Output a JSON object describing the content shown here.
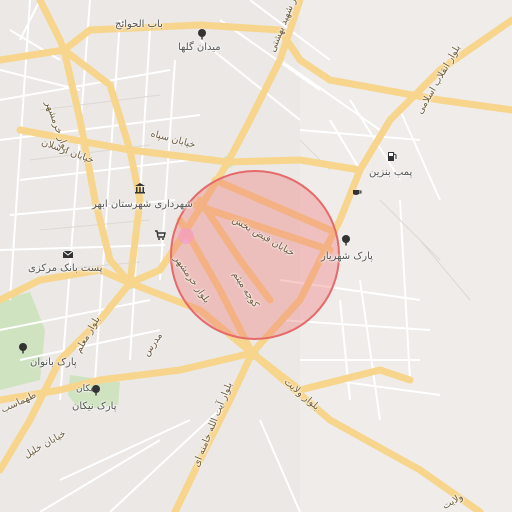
{
  "map": {
    "labels": {
      "bab_alhavaej": "باب الحوائج",
      "meydan_golha": "میدان گلها",
      "bolvar_sh_beheshti": "بلوار شهید بهشتی",
      "bolvar_enghelab": "بلوار انقلاب اسلامی",
      "bolvar_khorramshahr_n": "بلوار خرمشهر",
      "khiaban_sepah": "خیابان سپاه",
      "khiaban_arsalan": "خیابان ارسلان",
      "pomp_benzin": "پمپ بنزین",
      "shahrdari": "شهرداری شهرستان ابهر",
      "khiaban_feyz": "خیابان فیض بخش",
      "park_shahriar": "پارک شهریار",
      "post_bank": "پست بانک مرکزی",
      "bolvar_khorramshahr_s": "بلوار خرمشهر",
      "kooche_meysam": "کوچه میثم",
      "modarres": "مدرس",
      "bolvar_moallem": "بلوار معلم",
      "park_banovan": "پارک بانوان",
      "park_nikan": "پارک نیکان",
      "tahmasb": "طهماسب",
      "bolvar_velayat": "بلوار ولایت",
      "khiaban_khalil": "خیابان خلیل",
      "bolvar_ayatollah": "بلوار آیت الله خامنه ای",
      "velayat_corner": "ولایت",
      "nikan_short": "نیکان"
    },
    "colors": {
      "background": "#efecea",
      "major_road": "#f7d58c",
      "minor_road": "#ffffff",
      "park": "#cfe3c0",
      "highlight": "#f07a7a"
    },
    "icons": [
      "tree-icon",
      "fuel-pump-icon",
      "cafe-icon",
      "museum-icon",
      "shopping-cart-icon",
      "envelope-icon"
    ]
  }
}
